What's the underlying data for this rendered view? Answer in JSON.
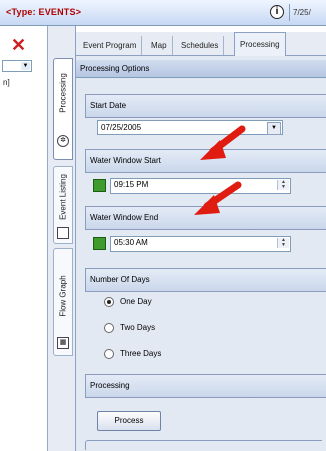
{
  "window": {
    "title": "<Type: EVENTS>",
    "date_stub": "7/25/"
  },
  "left_panel": {
    "text": "n]"
  },
  "side_tabs": [
    {
      "label": "Processing"
    },
    {
      "label": "Event Listing"
    },
    {
      "label": "Flow Graph"
    }
  ],
  "top_tabs": [
    {
      "label": "Event Program"
    },
    {
      "label": "Map"
    },
    {
      "label": "Schedules"
    },
    {
      "label": "Processing"
    }
  ],
  "panel": {
    "header": "Processing Options",
    "start_date": {
      "label": "Start Date",
      "value": "07/25/2005"
    },
    "water_start": {
      "label": "Water Window Start",
      "value": "09:15 PM"
    },
    "water_end": {
      "label": "Water Window End",
      "value": "05:30 AM"
    },
    "days": {
      "label": "Number Of Days",
      "options": [
        "One Day",
        "Two Days",
        "Three Days"
      ],
      "selected": "One Day"
    },
    "processing": {
      "label": "Processing",
      "button": "Process"
    }
  },
  "colors": {
    "accent_red": "#e01b10",
    "check_green": "#3f9b2e"
  }
}
